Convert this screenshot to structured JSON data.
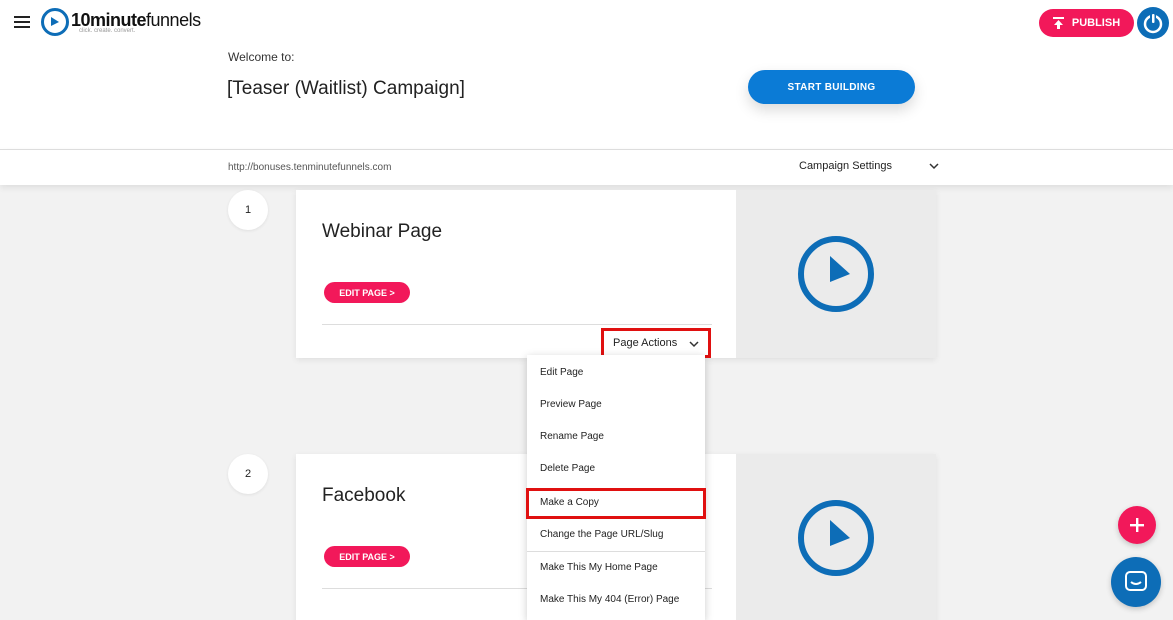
{
  "header": {
    "logo_bold": "10minute",
    "logo_light": "funnels",
    "logo_tagline": "click. create. convert.",
    "publish_label": "PUBLISH",
    "welcome_label": "Welcome to:",
    "campaign_title": "[Teaser (Waitlist) Campaign]",
    "start_building_label": "START BUILDING"
  },
  "urlbar": {
    "url": "http://bonuses.tenminutefunnels.com",
    "settings_label": "Campaign Settings"
  },
  "pages": [
    {
      "step": "1",
      "title": "Webinar Page",
      "edit_label": "EDIT PAGE >",
      "actions_label": "Page Actions"
    },
    {
      "step": "2",
      "title": "Facebook",
      "edit_label": "EDIT PAGE >"
    }
  ],
  "page_actions_menu": {
    "items": [
      "Edit Page",
      "Preview Page",
      "Rename Page",
      "Delete Page",
      "Make a Copy",
      "Change the Page URL/Slug",
      "Make This My Home Page",
      "Make This My 404 (Error) Page"
    ],
    "highlighted_item": "Make a Copy"
  },
  "colors": {
    "brand_blue": "#0d6db7",
    "accent_pink": "#f2185a",
    "highlight_red": "#e01010"
  },
  "icons": [
    "hamburger-icon",
    "clock-logo-icon",
    "upload-icon",
    "power-icon",
    "chevron-down-icon",
    "plus-icon",
    "chat-icon"
  ]
}
